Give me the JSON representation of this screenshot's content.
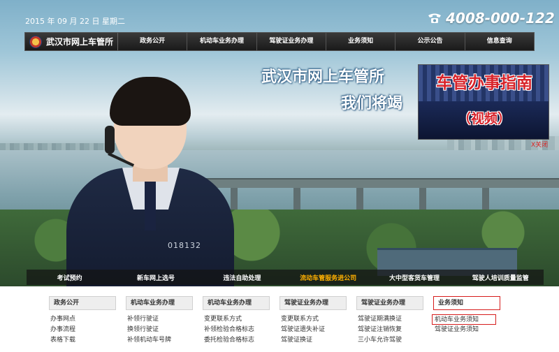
{
  "header": {
    "date": "2015 年 09 月 22 日 星期二",
    "hotline": "4008-000-122"
  },
  "nav": {
    "logo": "武汉市网上车管所",
    "items": [
      "政务公开",
      "机动车业务办理",
      "驾驶证业务办理",
      "业务须知",
      "公示公告",
      "信息查询"
    ]
  },
  "banner": {
    "slogan_line1": "武汉市网上车管所",
    "slogan_line2": "我们将竭",
    "badge_number": "018132"
  },
  "guide": {
    "title": "车管办事指南",
    "subtitle": "（视频）",
    "close": "X关闭"
  },
  "services": {
    "items": [
      "考试预约",
      "新车网上选号",
      "违法自助处理",
      "流动车管服务进公司",
      "大中型客货车管理",
      "驾驶人培训质量监管"
    ],
    "active_index": 3
  },
  "columns": [
    {
      "title": "政务公开",
      "items": [
        "办事网点",
        "办事流程",
        "表格下载"
      ]
    },
    {
      "title": "机动车业务办理",
      "items": [
        "补领行驶证",
        "换领行驶证",
        "补领机动车号牌"
      ]
    },
    {
      "title": "机动车业务办理",
      "items": [
        "变更联系方式",
        "补领检验合格标志",
        "委托检验合格标志"
      ]
    },
    {
      "title": "驾驶证业务办理",
      "items": [
        "变更联系方式",
        "驾驶证遗失补证",
        "驾驶证换证"
      ]
    },
    {
      "title": "驾驶证业务办理",
      "items": [
        "驾驶证期满换证",
        "驾驶证注销恢复",
        "三小车允许驾驶"
      ]
    },
    {
      "title": "业务须知",
      "items": [
        "机动车业务须知",
        "驾驶证业务须知"
      ],
      "highlight_title": true,
      "highlight_item": 0
    }
  ],
  "colors": {
    "accent_red": "#d61c1c",
    "active_orange": "#ffb000",
    "nav_bg": "#1a1a1a"
  }
}
